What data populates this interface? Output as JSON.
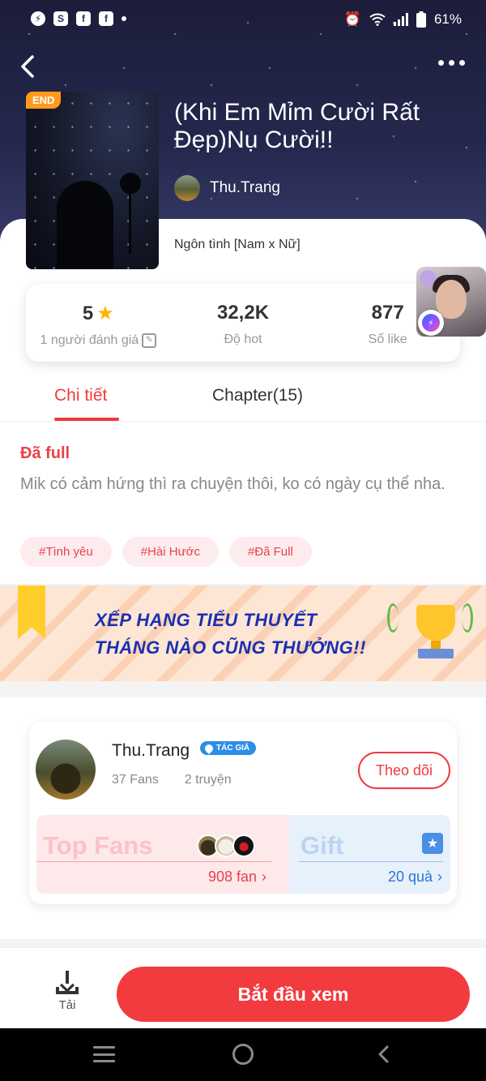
{
  "status_bar": {
    "battery": "61%"
  },
  "story": {
    "title": "(Khi Em Mỉm Cười Rất Đẹp)Nụ Cười!!",
    "end_badge": "END",
    "author": "Thu.Trang",
    "genre": "Ngôn tình [Nam x Nữ]"
  },
  "stats": [
    {
      "value": "5",
      "label": "1 người đánh giá"
    },
    {
      "value": "32,2K",
      "label": "Độ hot"
    },
    {
      "value": "877",
      "label": "Số like"
    }
  ],
  "tabs": {
    "detail": "Chi tiết",
    "chapters": "Chapter(15)"
  },
  "detail": {
    "status": "Đã full",
    "description": "Mik có cảm hứng thì ra chuyện thôi, ko có ngày cụ thể nha.",
    "tags": [
      "#Tình yêu",
      "#Hài Hước",
      "#Đã Full"
    ]
  },
  "banner": {
    "line1": "XẾP HẠNG TIỂU THUYẾT",
    "line2": "THÁNG NÀO CŨNG THƯỞNG!!"
  },
  "author_card": {
    "name": "Thu.Trang",
    "badge": "TÁC GIẢ",
    "fans": "37 Fans",
    "stories": "2 truyện",
    "follow": "Theo dõi",
    "top_fans_label": "Top Fans",
    "top_fans_count": "908 fan",
    "gift_label": "Gift",
    "gift_count": "20 quà"
  },
  "bottom": {
    "download": "Tải",
    "start": "Bắt đầu xem"
  },
  "icons": {
    "status_left": [
      "messenger-icon",
      "shopee-icon",
      "facebook-icon",
      "facebook-icon"
    ],
    "status_right": [
      "alarm-icon",
      "wifi-icon",
      "signal-icon",
      "battery-icon"
    ]
  },
  "colors": {
    "accent": "#f0393d",
    "author_badge": "#2d8ee8",
    "end_badge": "#ff9a1f",
    "banner_text": "#1a2fb3"
  }
}
